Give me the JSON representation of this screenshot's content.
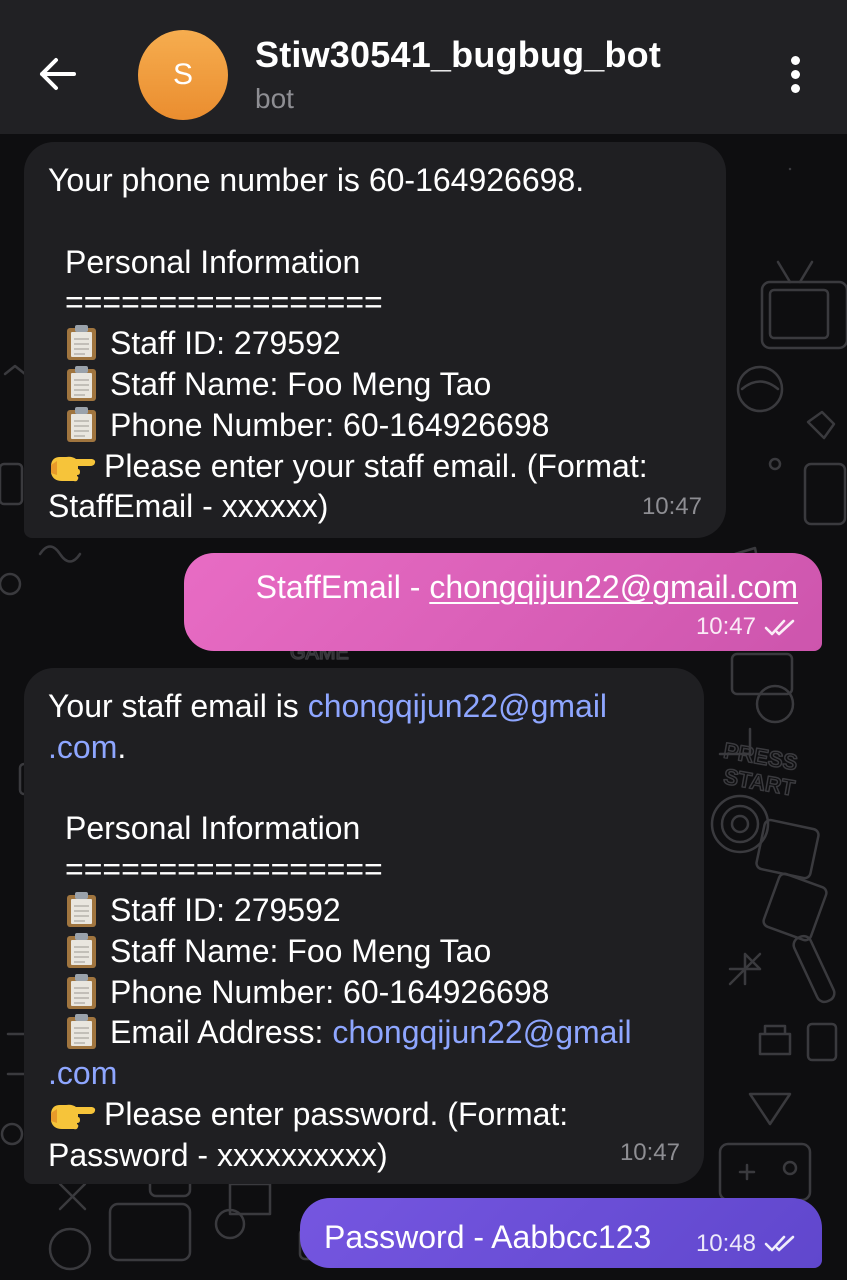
{
  "header": {
    "avatar_letter": "S",
    "title": "Stiw30541_bugbug_bot",
    "subtitle": "bot"
  },
  "messages": [
    {
      "direction": "incoming",
      "lines": {
        "phone_intro": "Your phone number is 60-164926698.",
        "section_title": "Personal Information",
        "divider": "=================",
        "staff_id": "Staff ID: 279592",
        "staff_name": "Staff Name: Foo Meng Tao",
        "phone_number": "Phone Number: 60-164926698",
        "prompt_line1": "Please enter your staff email. (Format:",
        "prompt_line2": "StaffEmail - xxxxxx)"
      },
      "time": "10:47"
    },
    {
      "direction": "outgoing",
      "prefix": "StaffEmail - ",
      "email": "chongqijun22@gmail.com",
      "time": "10:47"
    },
    {
      "direction": "incoming",
      "lines": {
        "email_intro": "Your staff email is ",
        "email_part1": "chongqijun22@gmail",
        "email_part2": ".com",
        "email_suffix": ".",
        "section_title": "Personal Information",
        "divider": "=================",
        "staff_id": "Staff ID: 279592",
        "staff_name": "Staff Name: Foo Meng Tao",
        "phone_number": "Phone Number: 60-164926698",
        "email_label": "Email Address: ",
        "email_value_part1": "chongqijun22@gmail",
        "email_value_part2": ".com",
        "prompt_line1": "Please enter password. (Format:",
        "prompt_line2": "Password - xxxxxxxxxx)"
      },
      "time": "10:47"
    },
    {
      "direction": "outgoing",
      "text": "Password - Aabbcc123",
      "time": "10:48"
    }
  ],
  "colors": {
    "header_bg": "#212124",
    "incoming_bubble": "#1f1f22",
    "outgoing_pink": "#d35ab0",
    "outgoing_purple": "#6b52d6",
    "link": "#8ea6ff",
    "avatar": "#f0a040"
  },
  "icons": {
    "back": "arrow-left-icon",
    "more": "more-vertical-icon",
    "clipboard": "clipboard-emoji",
    "pointing": "backhand-index-pointing-right-emoji",
    "read": "double-check-icon"
  }
}
